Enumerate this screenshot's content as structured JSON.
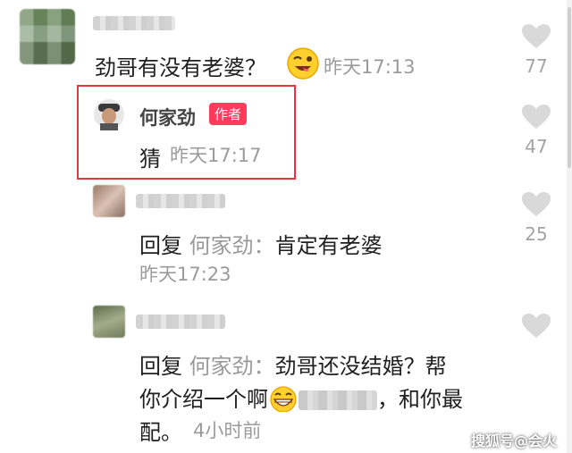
{
  "comment": {
    "text": "劲哥有没有老婆？",
    "time": "昨天17:13",
    "likes": "77"
  },
  "author_reply": {
    "name": "何家劲",
    "badge": "作者",
    "text": "猜",
    "time": "昨天17:17",
    "likes": "47"
  },
  "reply1": {
    "prefix": "回复",
    "target": "何家劲：",
    "text": "肯定有老婆",
    "time": "昨天17:23",
    "likes": "25"
  },
  "reply2": {
    "prefix": "回复",
    "target": "何家劲：",
    "line1": "劲哥还没结婚？帮",
    "line2a": "你介绍一个啊",
    "line2b": "，和你最",
    "line3": "配。",
    "time": "4小时前"
  },
  "watermark": "搜狐号@会火",
  "colors": {
    "badge": "#ff3b5c",
    "highlight_box": "#e23a3a",
    "muted": "#9b9b9b"
  },
  "icons": [
    "heart-icon",
    "wink-emoji",
    "grin-emoji"
  ]
}
